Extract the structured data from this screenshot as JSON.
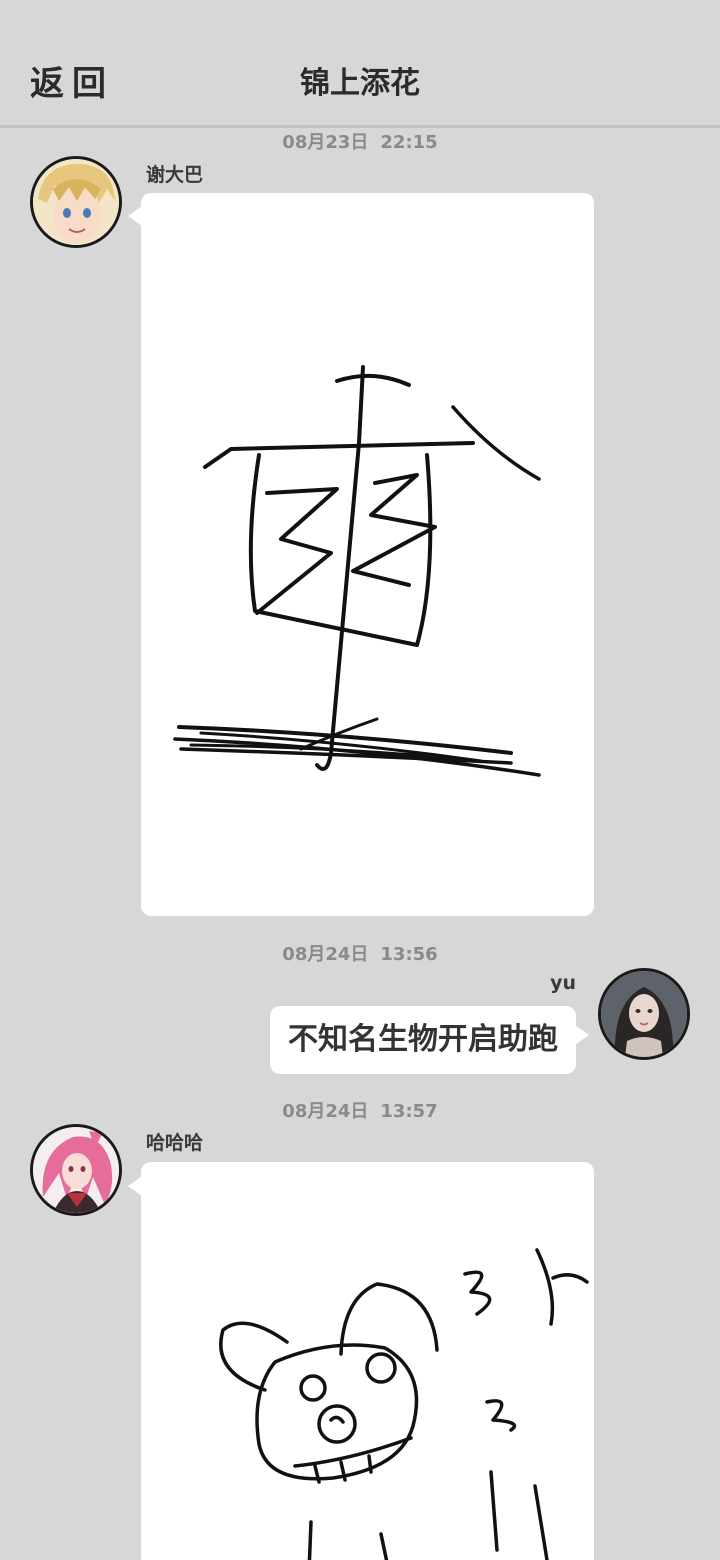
{
  "header": {
    "back_label": "返回",
    "title": "锦上添花"
  },
  "messages": [
    {
      "timestamp_date": "08月23日",
      "timestamp_time": "22:15",
      "sender": "谢大巴",
      "type": "drawing",
      "side": "left"
    },
    {
      "timestamp_date": "08月24日",
      "timestamp_time": "13:56",
      "sender": "yu",
      "type": "text",
      "side": "right",
      "text": "不知名生物开启助跑"
    },
    {
      "timestamp_date": "08月24日",
      "timestamp_time": "13:57",
      "sender": "哈哈哈",
      "type": "drawing",
      "side": "left"
    }
  ],
  "colors": {
    "background": "#d7d7d7",
    "bubble": "#ffffff",
    "text": "#333333",
    "timestamp": "#8a8a8a"
  }
}
